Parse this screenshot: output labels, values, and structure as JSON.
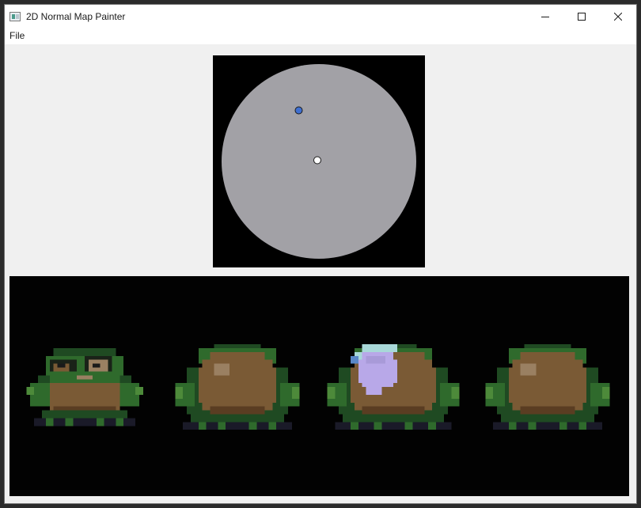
{
  "window": {
    "title": "2D Normal Map Painter",
    "icon": "app-icon",
    "controls": {
      "minimize": "minimize-icon",
      "maximize": "maximize-icon",
      "close": "close-icon"
    }
  },
  "menu": {
    "items": [
      {
        "label": "File"
      }
    ]
  },
  "picker": {
    "icon": "normal-sphere",
    "sphere_color": "#a2a1a6",
    "background": "#000000",
    "light_handle_color": "#3f6fd0",
    "normal_handle_color": "#ffffff"
  },
  "preview": {
    "background": "#020202",
    "sprites": [
      {
        "name": "frog-sprite-1",
        "variant": "frog with face"
      },
      {
        "name": "frog-sprite-2",
        "variant": "frog shell"
      },
      {
        "name": "frog-sprite-3",
        "variant": "frog shell with painted normal region"
      },
      {
        "name": "frog-sprite-4",
        "variant": "frog shell"
      }
    ],
    "palette": {
      "dark_green": "#1f4a22",
      "mid_green": "#2f6a2c",
      "light_green": "#4d8a3a",
      "shell_brown": "#7a5a35",
      "shell_dark": "#5a3d22",
      "shell_highlight": "#9a8062",
      "shadow": "#1a1a28",
      "paint_lavender": "#b8a8e8",
      "paint_cyan": "#a8d8d8"
    }
  }
}
